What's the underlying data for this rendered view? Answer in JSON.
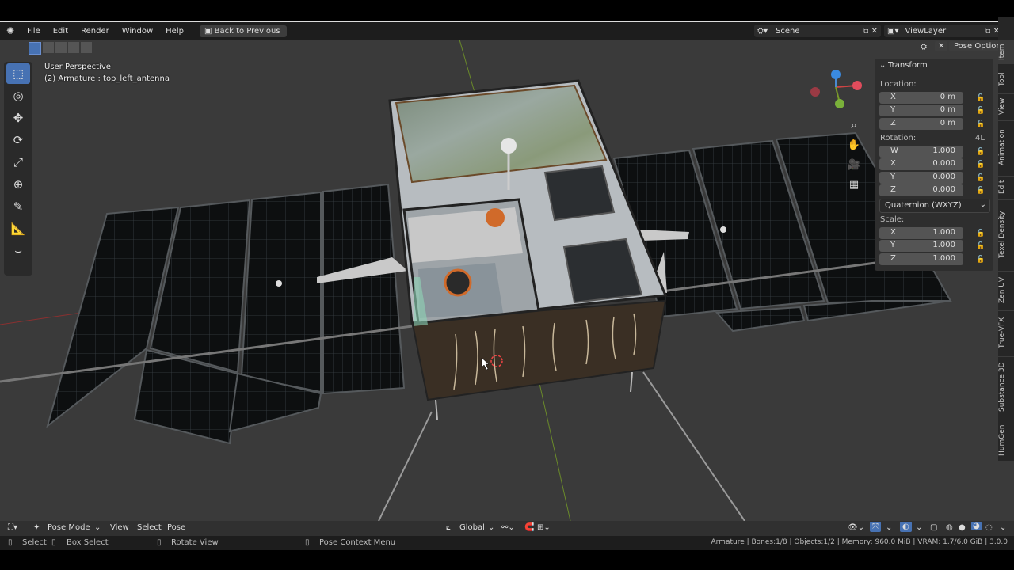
{
  "menubar": {
    "items": [
      "File",
      "Edit",
      "Render",
      "Window",
      "Help"
    ],
    "back_button": "Back to Previous",
    "scene_name": "Scene",
    "view_layer": "ViewLayer"
  },
  "viewport": {
    "perspective_label": "User Perspective",
    "active_object": "(2) Armature : top_left_antenna",
    "pose_options": "Pose Options"
  },
  "transform_panel": {
    "title": "Transform",
    "location_label": "Location:",
    "location": [
      {
        "axis": "X",
        "value": "0 m"
      },
      {
        "axis": "Y",
        "value": "0 m"
      },
      {
        "axis": "Z",
        "value": "0 m"
      }
    ],
    "rotation_label": "Rotation:",
    "rotation_mode_short": "4L",
    "rotation": [
      {
        "axis": "W",
        "value": "1.000"
      },
      {
        "axis": "X",
        "value": "0.000"
      },
      {
        "axis": "Y",
        "value": "0.000"
      },
      {
        "axis": "Z",
        "value": "0.000"
      }
    ],
    "rotation_mode": "Quaternion (WXYZ)",
    "scale_label": "Scale:",
    "scale": [
      {
        "axis": "X",
        "value": "1.000"
      },
      {
        "axis": "Y",
        "value": "1.000"
      },
      {
        "axis": "Z",
        "value": "1.000"
      }
    ]
  },
  "sidebar_tabs": [
    "Item",
    "Tool",
    "View",
    "Animation",
    "Edit",
    "Texel Density",
    "Zen UV",
    "True-VFX",
    "Substance 3D",
    "HumGen"
  ],
  "bottom_header": {
    "mode": "Pose Mode",
    "menus": [
      "View",
      "Select",
      "Pose"
    ],
    "orientation": "Global"
  },
  "statusbar": {
    "select": "Select",
    "box_select": "Box Select",
    "rotate_view": "Rotate View",
    "context_menu": "Pose Context Menu",
    "stats": "Armature | Bones:1/8 | Objects:1/2 | Memory: 960.0 MiB | VRAM: 1.7/6.0 GiB | 3.0.0"
  },
  "colors": {
    "accent": "#4772b3",
    "viewport_bg": "#3a3a3a",
    "panel_bg": "#2e2e2e"
  }
}
